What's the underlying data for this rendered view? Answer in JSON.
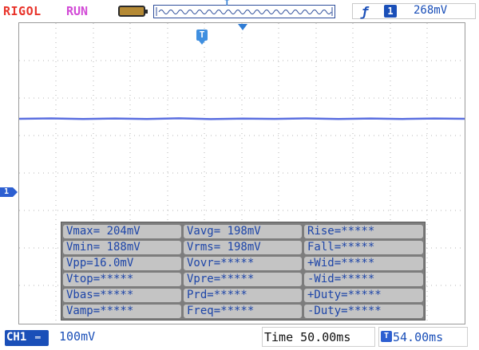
{
  "header": {
    "brand": "RIGOL",
    "run_state": "RUN",
    "trigger_marker": "T",
    "trigger_channel": "1",
    "trigger_level": "268mV"
  },
  "screen": {
    "trigger_time_marker": "T",
    "channel_marker": "1",
    "trace_color": "#5b6fe0",
    "measurements": [
      [
        "Vmax= 204mV",
        "Vavg= 198mV",
        "Rise=*****"
      ],
      [
        "Vmin= 188mV",
        "Vrms= 198mV",
        "Fall=*****"
      ],
      [
        "Vpp=16.0mV",
        "Vovr=*****",
        "+Wid=*****"
      ],
      [
        "Vtop=*****",
        "Vpre=*****",
        "-Wid=*****"
      ],
      [
        "Vbas=*****",
        "Prd=*****",
        "+Duty=*****"
      ],
      [
        "Vamp=*****",
        "Freq=*****",
        "-Duty=*****"
      ]
    ]
  },
  "footer": {
    "channel_label": "CH1",
    "coupling_icon": "dc-coupling-icon",
    "volts_per_div": "100mV",
    "timebase": "Time 50.00ms",
    "offset_icon": "T",
    "trigger_offset": "54.00ms"
  },
  "colors": {
    "brand": "#e8332a",
    "run": "#d24ad6",
    "accent": "#1a4fb8",
    "grid": "#bdbdbd",
    "panel": "#7d7d7d",
    "cell": "#c4c4c4"
  }
}
